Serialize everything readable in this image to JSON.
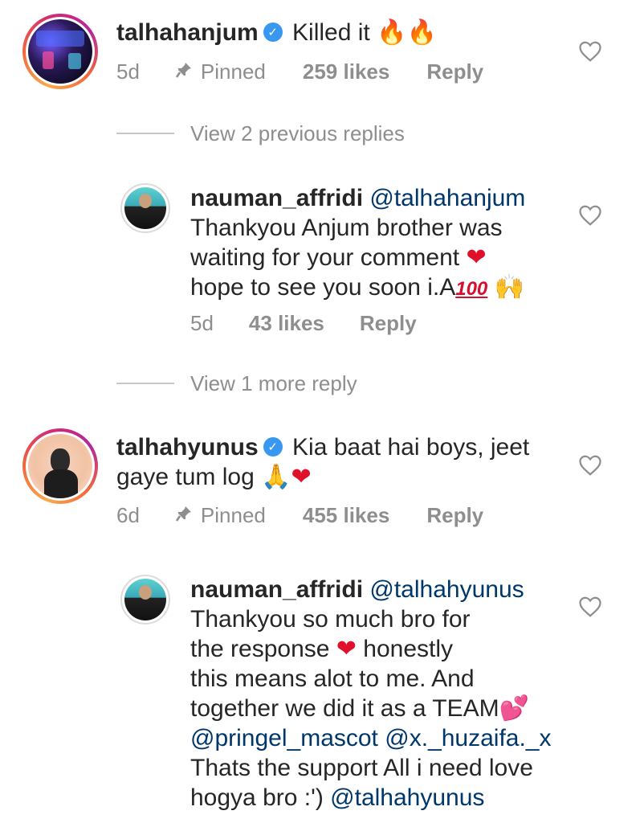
{
  "colors": {
    "text": "#262626",
    "secondary": "#8e8e8e",
    "mention": "#00376b",
    "verified": "#3897f0"
  },
  "comment1": {
    "username": "talhahanjum",
    "text": "Killed it",
    "emoji": "🔥🔥",
    "time": "5d",
    "pinned": "Pinned",
    "likes": "259 likes",
    "reply": "Reply",
    "view_replies": "View 2 previous replies"
  },
  "reply1": {
    "username": "nauman_affridi",
    "mention": "@talhahanjum",
    "line1": "Thankyou Anjum brother was",
    "line2": "waiting for your comment",
    "emoji_heart": "❤",
    "line3": "hope to see you soon i.A",
    "emoji_100": "100",
    "emoji_hands": "🙌",
    "time": "5d",
    "likes": "43 likes",
    "reply": "Reply",
    "view_more": "View 1 more reply"
  },
  "comment2": {
    "username": "talhahyunus",
    "line1": "Kia baat hai boys, jeet",
    "line2": "gaye tum log",
    "emoji_pray": "🙏",
    "emoji_heart": "❤",
    "time": "6d",
    "pinned": "Pinned",
    "likes": "455 likes",
    "reply": "Reply"
  },
  "reply2": {
    "username": "nauman_affridi",
    "mention": "@talhahyunus",
    "line1": "Thankyou so much bro for",
    "line2a": "the response",
    "emoji_heart": "❤",
    "line2b": "honestly",
    "line3": "this means alot to me. And",
    "line4": "together we did it as a TEAM",
    "emoji_hearts": "💕",
    "mention2": "@pringel_mascot",
    "mention3": "@x._huzaifa._x",
    "line6": "Thats the support All i need love",
    "line7": "hogya bro :')",
    "mention4": "@talhahyunus"
  }
}
